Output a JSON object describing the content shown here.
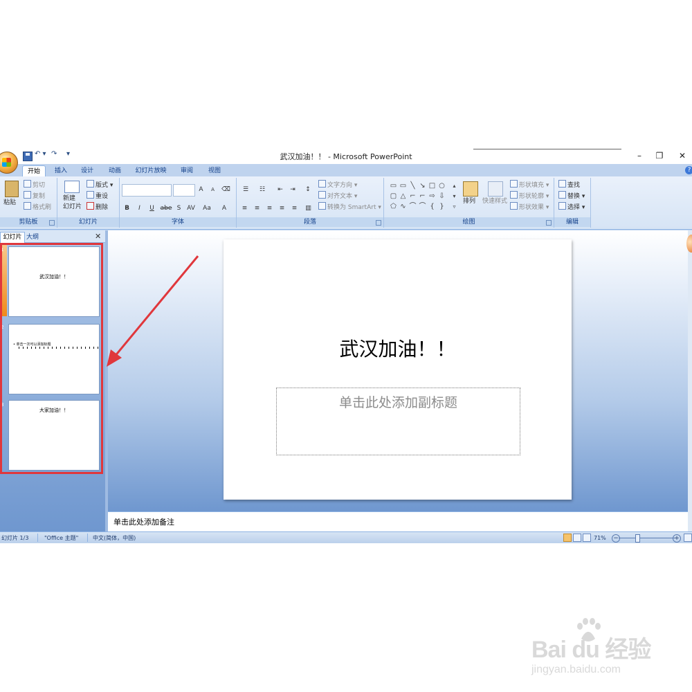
{
  "window": {
    "title": "武汉加油！！ - Microsoft PowerPoint",
    "controls": {
      "minimize": "–",
      "maximize": "❐",
      "close": "✕"
    }
  },
  "quick_access": {
    "undo": "↶ ▾",
    "redo": "↷",
    "more": "▾"
  },
  "ribbon_tabs": [
    "开始",
    "插入",
    "设计",
    "动画",
    "幻灯片放映",
    "审阅",
    "视图"
  ],
  "ribbon": {
    "clipboard": {
      "label": "剪贴板",
      "paste": "粘贴",
      "cut": "剪切",
      "copy": "复制",
      "format_painter": "格式刷"
    },
    "slides": {
      "label": "幻灯片",
      "new_slide": "新建\n幻灯片",
      "layout": "版式",
      "reset": "重设",
      "delete": "删除"
    },
    "font": {
      "label": "字体",
      "grow": "A",
      "shrink": "A",
      "clear": "⌫",
      "bold": "B",
      "italic": "I",
      "underline": "U",
      "strike": "abe",
      "shadow": "S",
      "spacing": "AV",
      "case": "Aa",
      "color": "A"
    },
    "paragraph": {
      "label": "段落",
      "text_direction": "文字方向",
      "align_text": "对齐文本",
      "smartart": "转换为 SmartArt"
    },
    "drawing": {
      "label": "绘图",
      "arrange": "排列",
      "quick_styles": "快速样式",
      "shape_fill": "形状填充",
      "shape_outline": "形状轮廓",
      "shape_effects": "形状效果"
    },
    "editing": {
      "label": "编辑",
      "find": "查找",
      "replace": "替换",
      "select": "选择"
    }
  },
  "slides_pane": {
    "tab_slides": "幻灯片",
    "tab_outline": "大纲",
    "close": "✕",
    "thumbnails": [
      {
        "number": "1",
        "text": "武汉加油！！",
        "selected": true
      },
      {
        "number": "2",
        "text": "• 单击一次可以添加标题",
        "selected": false
      },
      {
        "number": "3",
        "text": "大家加油！！",
        "selected": false
      }
    ]
  },
  "slide": {
    "title": "武汉加油！！",
    "subtitle_placeholder": "单击此处添加副标题"
  },
  "notes": {
    "placeholder": "单击此处添加备注"
  },
  "status_bar": {
    "slide_indicator": "幻灯片 1/3",
    "theme": "\"Office 主题\"",
    "language": "中文(简体，中国)",
    "zoom": "71%",
    "zoom_out": "−",
    "zoom_in": "+"
  },
  "watermark": {
    "brand": "Bai  du 经验",
    "url": "jingyan.baidu.com"
  },
  "colors": {
    "highlight_red": "#e0373c",
    "ribbon_blue": "#15428b",
    "pane_blue": "#6f97cf"
  }
}
